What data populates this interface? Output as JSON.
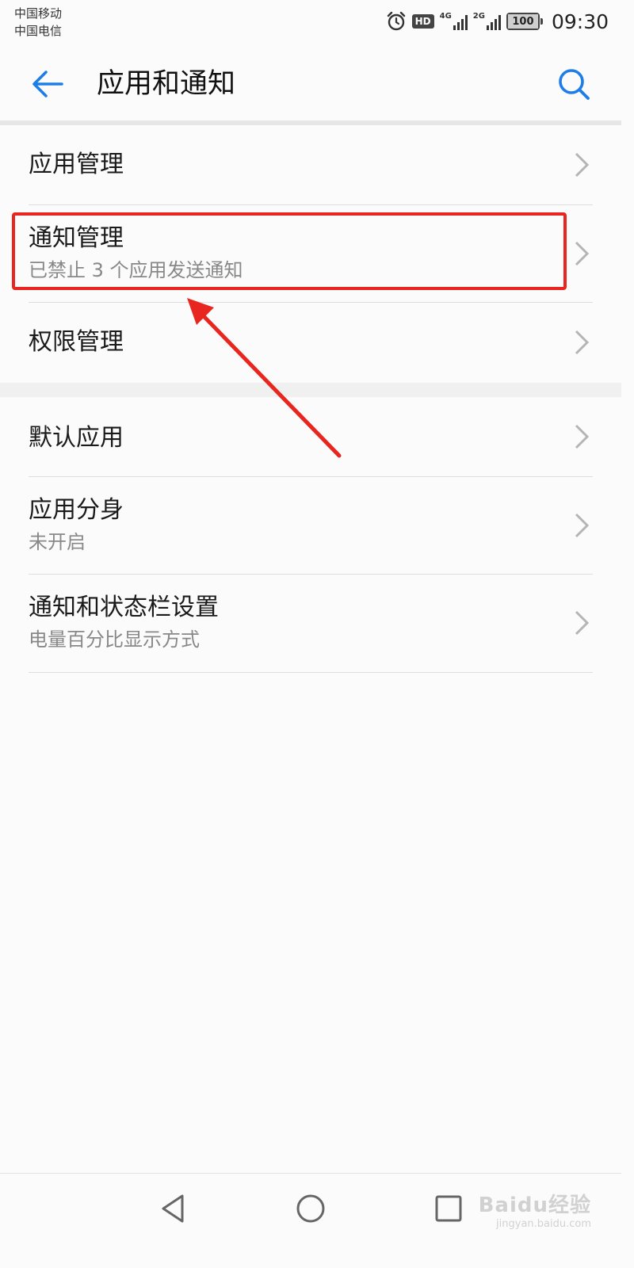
{
  "status_bar": {
    "carrier_1": "中国移动",
    "carrier_2": "中国电信",
    "hd": "HD",
    "net_1": "4G",
    "net_2": "2G",
    "battery": "100",
    "battery_level": 1.0,
    "time": "09:30"
  },
  "app_bar": {
    "title": "应用和通知"
  },
  "groups": [
    {
      "items": [
        {
          "title": "应用管理",
          "subtitle": ""
        },
        {
          "title": "通知管理",
          "subtitle": "已禁止 3 个应用发送通知"
        },
        {
          "title": "权限管理",
          "subtitle": ""
        }
      ]
    },
    {
      "items": [
        {
          "title": "默认应用",
          "subtitle": ""
        },
        {
          "title": "应用分身",
          "subtitle": "未开启"
        },
        {
          "title": "通知和状态栏设置",
          "subtitle": "电量百分比显示方式"
        }
      ]
    }
  ],
  "watermark": {
    "main": "Baidu经验",
    "url": "jingyan.baidu.com"
  },
  "colors": {
    "accent": "#1e7ee8",
    "annotation": "#e8261f",
    "text_primary": "#1a1a1a",
    "text_secondary": "#888888"
  }
}
